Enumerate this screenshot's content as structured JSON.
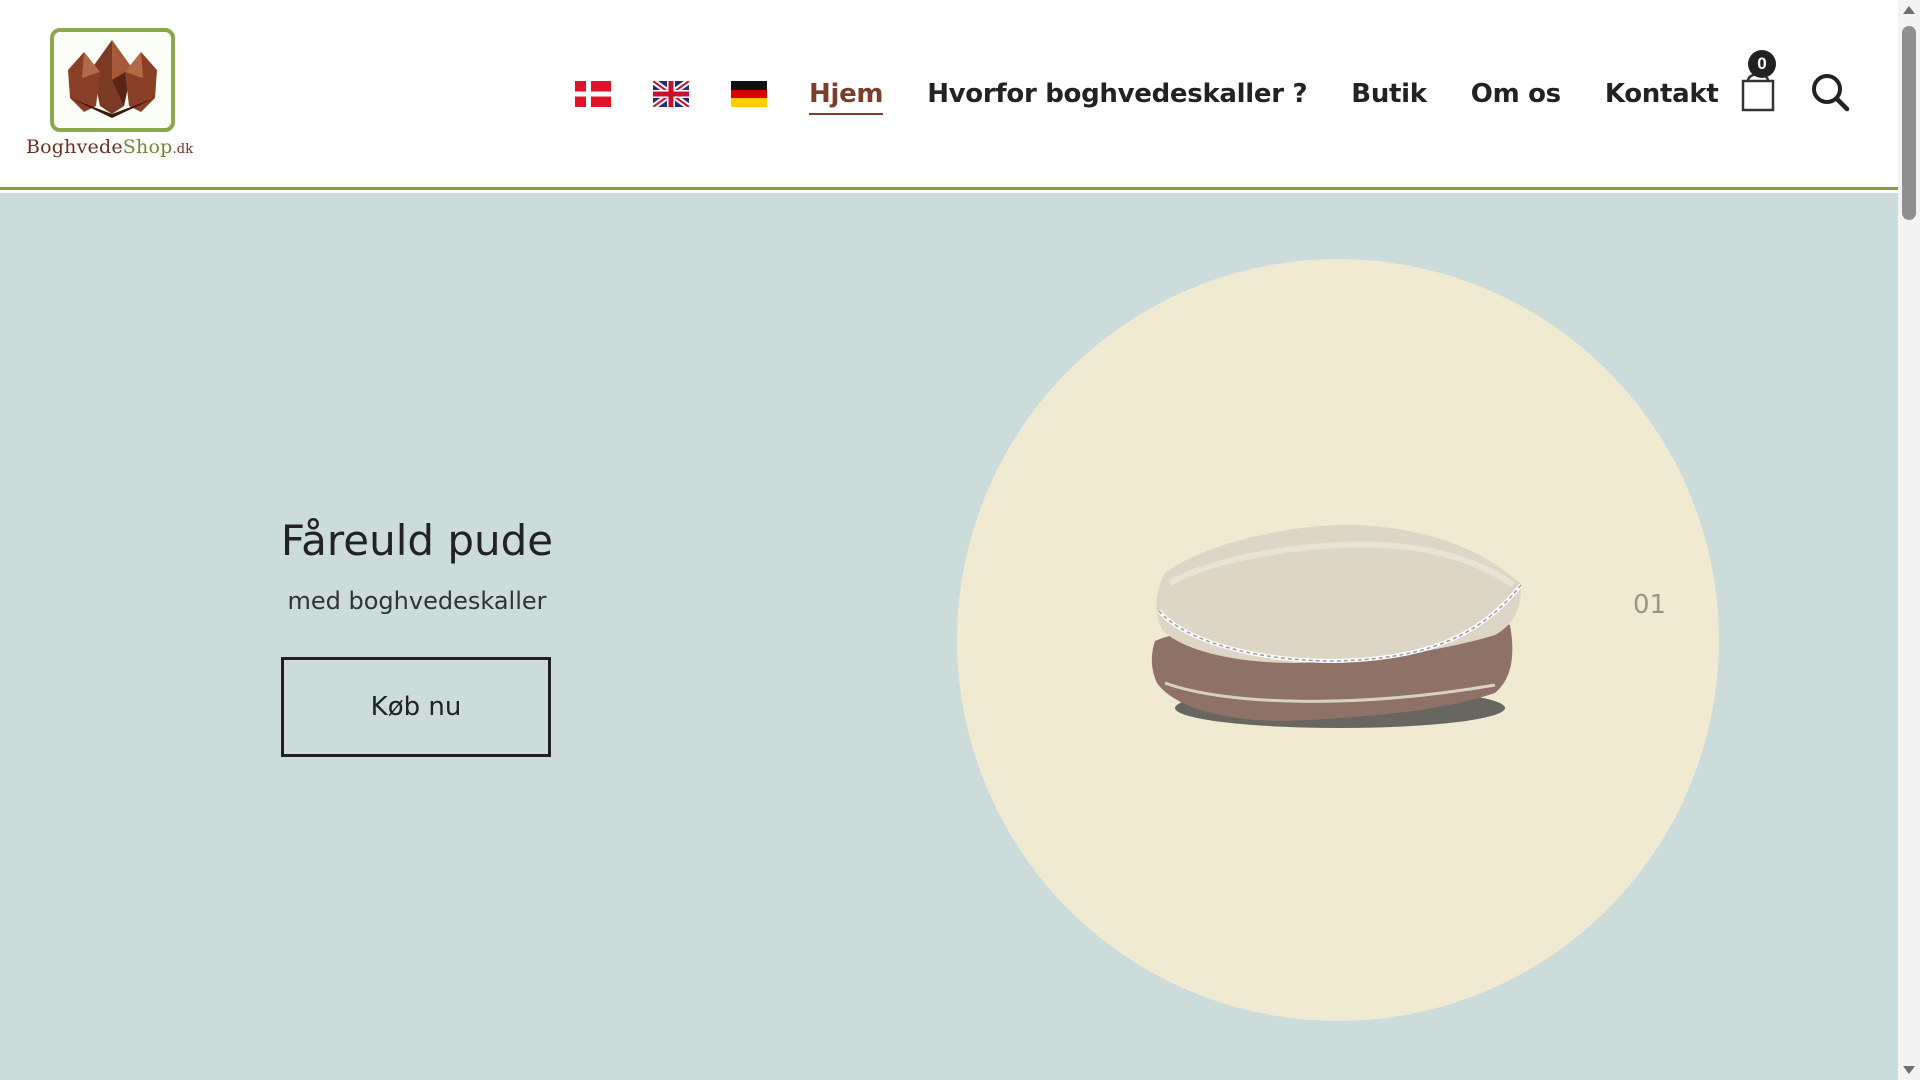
{
  "brand": {
    "logo_text_main": "BoghvedeShop",
    "logo_text_part1": "Boghvede",
    "logo_text_part2": "Shop",
    "logo_text_tld": ".dk"
  },
  "nav": {
    "flags": [
      {
        "name": "danish-flag",
        "language": "Dansk"
      },
      {
        "name": "english-flag",
        "language": "English"
      },
      {
        "name": "german-flag",
        "language": "Deutsch"
      }
    ],
    "links": [
      {
        "label": "Hjem",
        "active": true
      },
      {
        "label": "Hvorfor boghvedeskaller ?",
        "active": false
      },
      {
        "label": "Butik",
        "active": false
      },
      {
        "label": "Om os",
        "active": false
      },
      {
        "label": "Kontakt",
        "active": false
      }
    ],
    "cart_count": "0",
    "icons": [
      "shopping-bag-icon",
      "search-icon"
    ]
  },
  "hero": {
    "title": "Fåreuld pude",
    "subtitle": "med boghvedeskaller",
    "button_label": "Køb nu",
    "slide_number": "01",
    "image": "stacked-pillows"
  },
  "colors": {
    "accent": "#7a3e2a",
    "header_border": "#8a9a3a",
    "hero_background": "#cbdcdb",
    "circle": "#f0ead3",
    "text": "#222222"
  }
}
